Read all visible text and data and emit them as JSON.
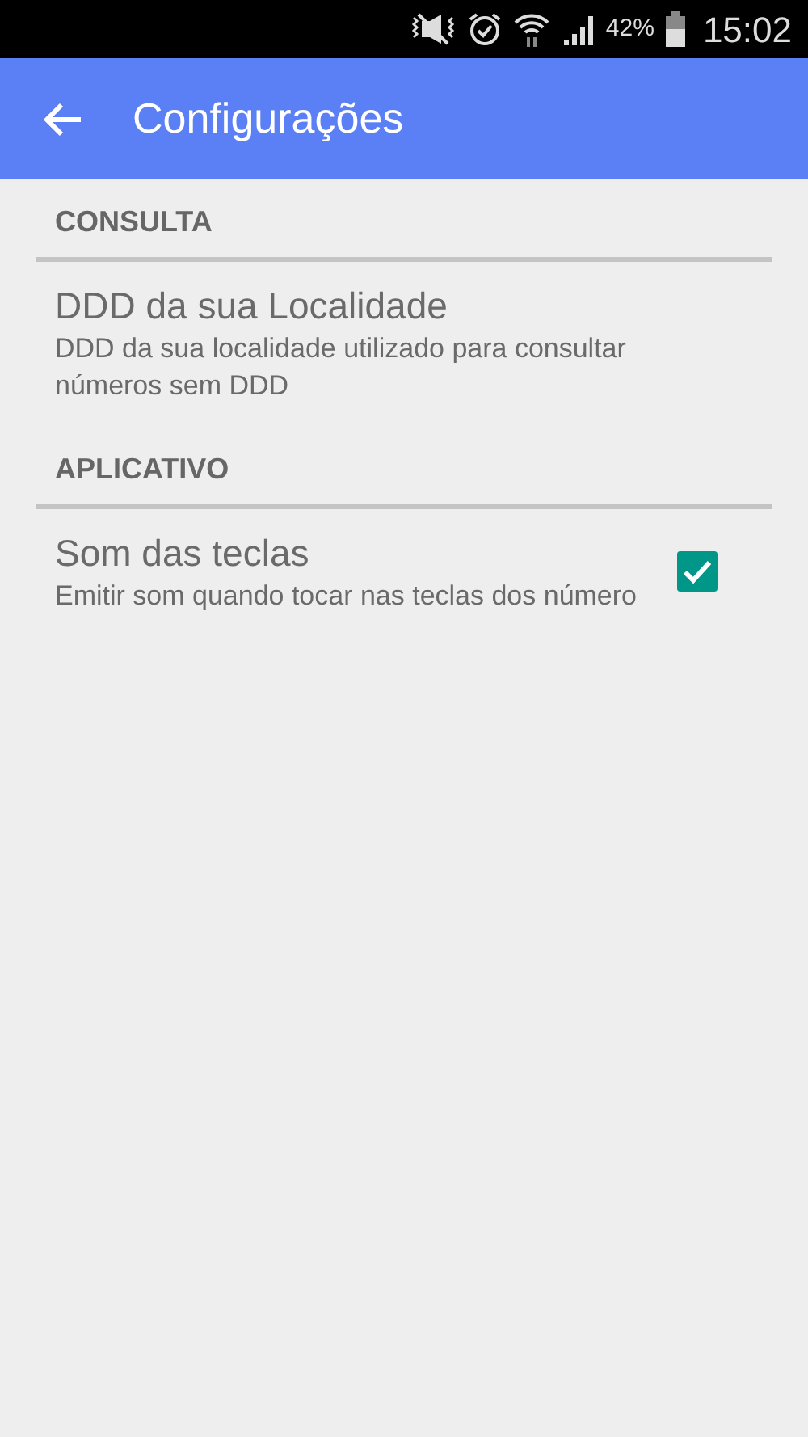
{
  "status_bar": {
    "battery": "42%",
    "time": "15:02"
  },
  "app_bar": {
    "title": "Configurações"
  },
  "sections": [
    {
      "header": "CONSULTA",
      "items": [
        {
          "kind": "text",
          "title": "DDD da sua Localidade",
          "summary": "DDD da sua localidade utilizado para consultar números sem DDD"
        }
      ]
    },
    {
      "header": "APLICATIVO",
      "items": [
        {
          "kind": "checkbox",
          "title": "Som das teclas",
          "summary": "Emitir som quando tocar nas teclas dos número",
          "checked": true
        }
      ]
    }
  ]
}
